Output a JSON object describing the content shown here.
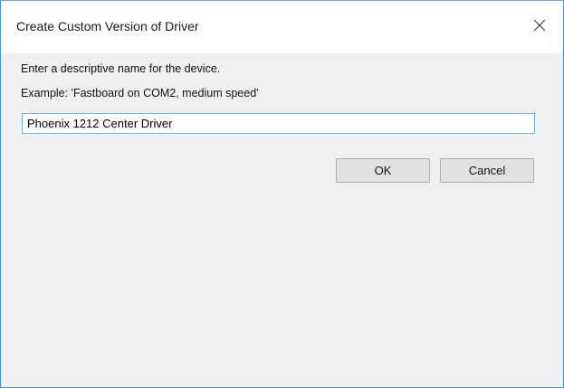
{
  "dialog": {
    "title": "Create Custom Version of Driver",
    "prompt": "Enter a descriptive name for the device.",
    "example": "Example: 'Fastboard on COM2, medium speed'",
    "name_value": "Phoenix 1212 Center Driver",
    "ok_label": "OK",
    "cancel_label": "Cancel",
    "close_icon": "close-icon"
  }
}
